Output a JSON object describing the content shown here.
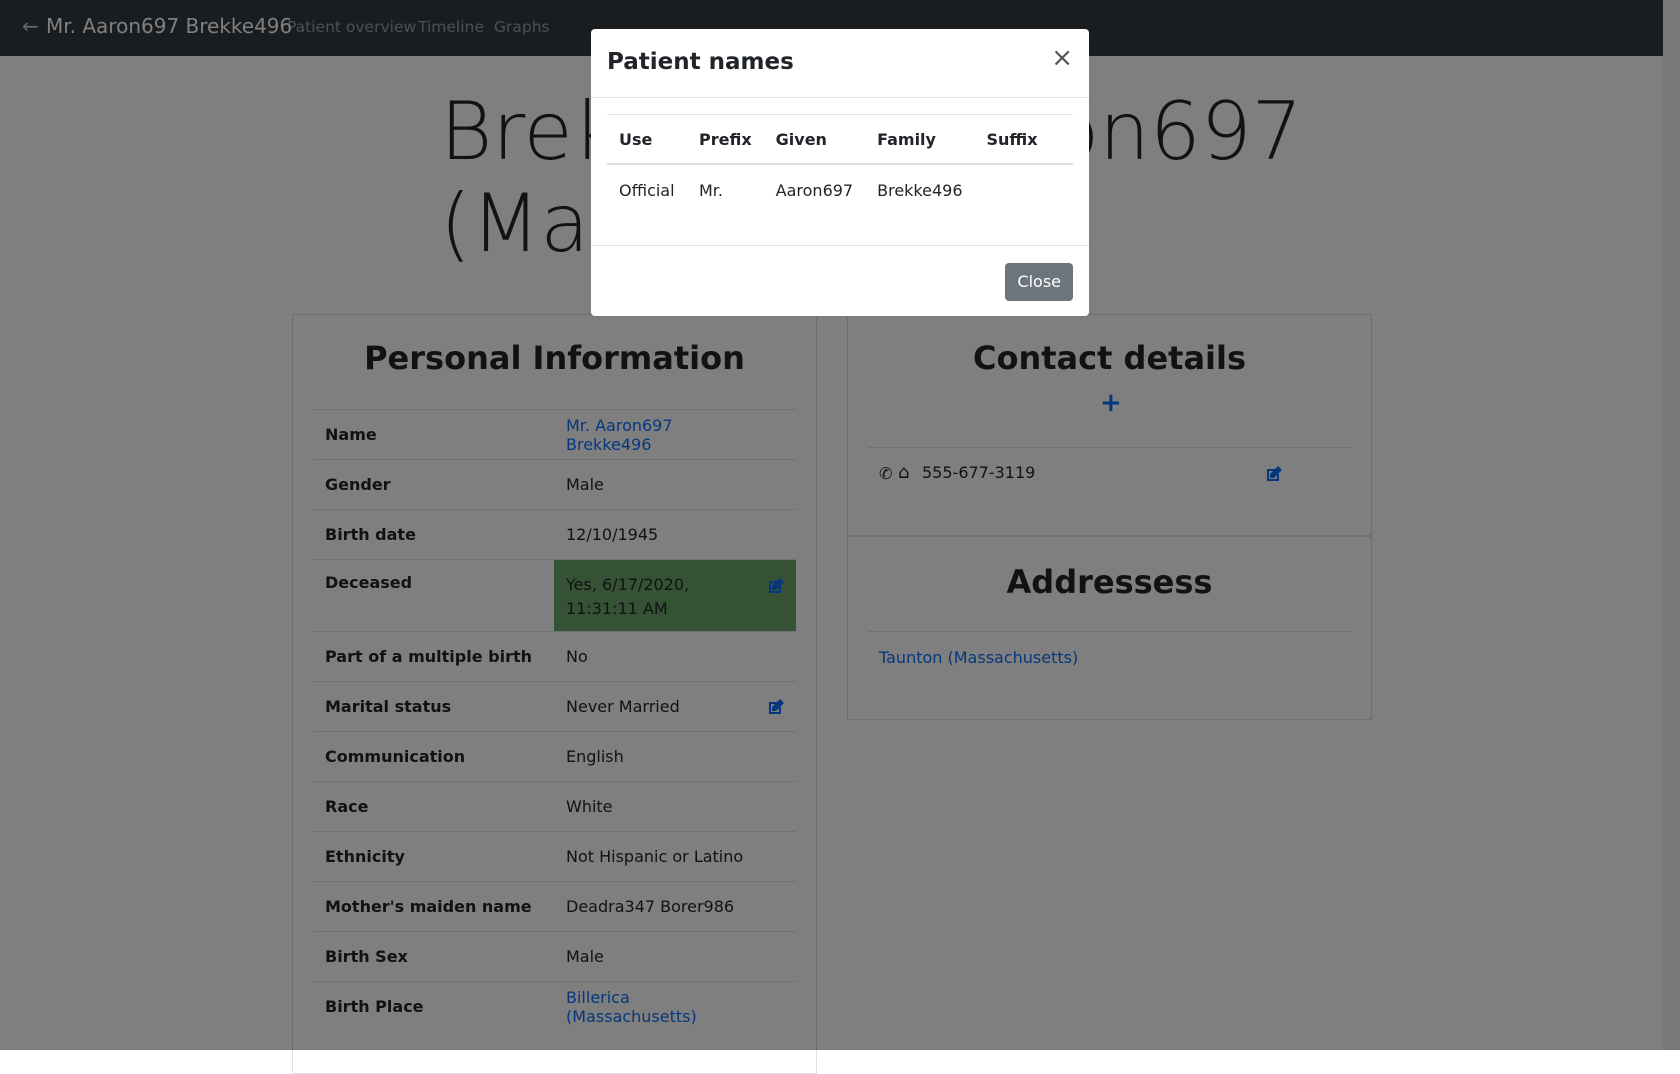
{
  "navbar": {
    "brand": "Mr. Aaron697 Brekke496",
    "links": [
      "Patient overview",
      "Timeline",
      "Graphs"
    ]
  },
  "heading": {
    "line1": "Brekke496, Aaron697",
    "line2": "(Male"
  },
  "personal": {
    "title": "Personal Information",
    "rows": [
      {
        "label": "Name",
        "value": "Mr. Aaron697 Brekke496"
      },
      {
        "label": "Gender",
        "value": "Male"
      },
      {
        "label": "Birth date",
        "value": "12/10/1945"
      },
      {
        "label": "Deceased",
        "value": "Yes, 6/17/2020, 11:31:11 AM"
      },
      {
        "label": "Part of a multiple birth",
        "value": "No"
      },
      {
        "label": "Marital status",
        "value": "Never Married"
      },
      {
        "label": "Communication",
        "value": "English"
      },
      {
        "label": "Race",
        "value": "White"
      },
      {
        "label": "Ethnicity",
        "value": "Not Hispanic or Latino"
      },
      {
        "label": "Mother's maiden name",
        "value": "Deadra347 Borer986"
      },
      {
        "label": "Birth Sex",
        "value": "Male"
      },
      {
        "label": "Birth Place",
        "value": "Billerica (Massachusetts)"
      }
    ]
  },
  "contact": {
    "title": "Contact details",
    "phone": "555-677-3119"
  },
  "addresses": {
    "title": "Addressess",
    "items": [
      "Taunton (Massachusetts)"
    ]
  },
  "modal": {
    "title": "Patient names",
    "close_x": "×",
    "columns": [
      "Use",
      "Prefix",
      "Given",
      "Family",
      "Suffix"
    ],
    "rows": [
      [
        "Official",
        "Mr.",
        "Aaron697",
        "Brekke496",
        ""
      ]
    ],
    "close_label": "Close"
  },
  "colors": {
    "navbar": "#343a40",
    "link": "#0d6efd",
    "deceased_bg": "#6aa56a",
    "close_button": "#6c757d"
  }
}
